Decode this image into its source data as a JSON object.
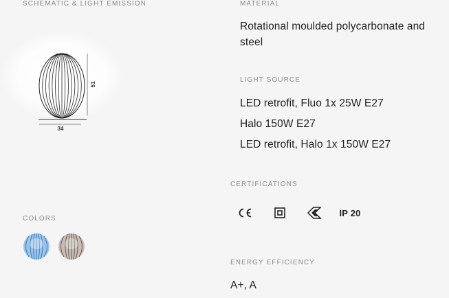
{
  "schematic": {
    "label": "SCHEMATIC & LIGHT EMISSION",
    "dim_height": "51",
    "dim_width": "34"
  },
  "colors": {
    "label": "COLORS",
    "swatches": [
      {
        "name": "light-blue",
        "color": "#7fb2e0"
      },
      {
        "name": "grey-brown",
        "color": "#a09690"
      }
    ]
  },
  "material": {
    "label": "MATERIAL",
    "value": "Rotational moulded polycarbonate and steel"
  },
  "light_source": {
    "label": "LIGHT SOURCE",
    "items": [
      "LED retrofit, Fluo 1x 25W E27",
      "Halo 150W E27",
      "LED retrofit, Halo 1x 150W E27"
    ]
  },
  "certifications": {
    "label": "CERTIFICATIONS",
    "items": [
      {
        "icon": "ce-mark-icon",
        "text": "CE"
      },
      {
        "icon": "double-insulation-icon",
        "text": ""
      },
      {
        "icon": "enec-mark-icon",
        "text": ""
      },
      {
        "icon": "ip-rating-icon",
        "text": "IP 20"
      }
    ]
  },
  "energy": {
    "label": "ENERGY EFFICIENCY",
    "value": "A+, A"
  }
}
